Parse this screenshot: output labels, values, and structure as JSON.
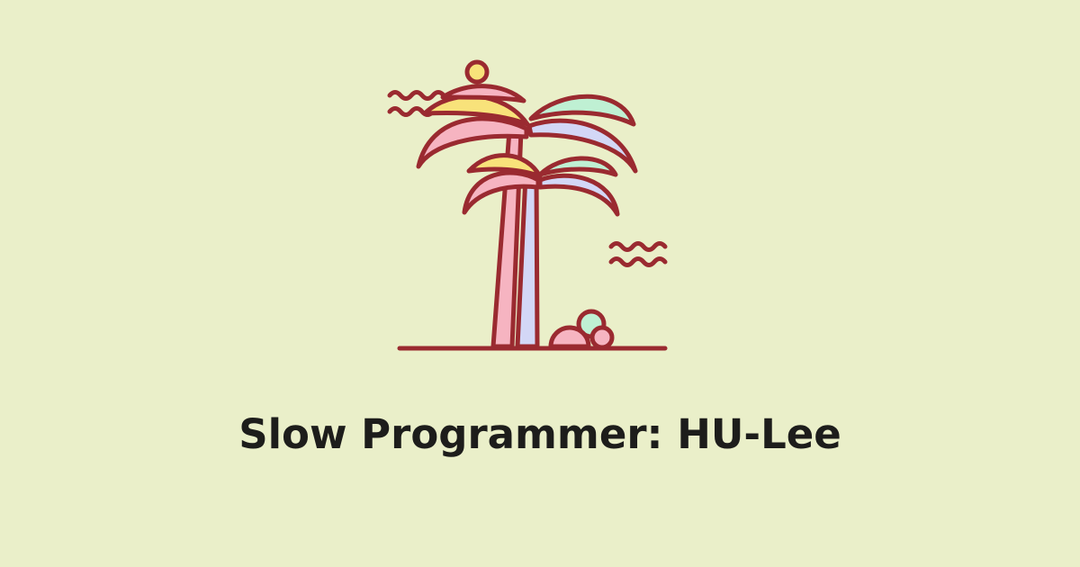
{
  "page": {
    "background_color": "#eaefc9",
    "title": "Slow Programmer: HU-Lee",
    "title_color": "#1d1d1b"
  },
  "illustration": {
    "icon": "palm-tree-icon",
    "stroke_color": "#9a2a30",
    "palette": {
      "pink": "#f6b4c1",
      "lavender": "#d3d7f6",
      "mint": "#bff0d3",
      "yellow": "#f8e27a"
    }
  }
}
